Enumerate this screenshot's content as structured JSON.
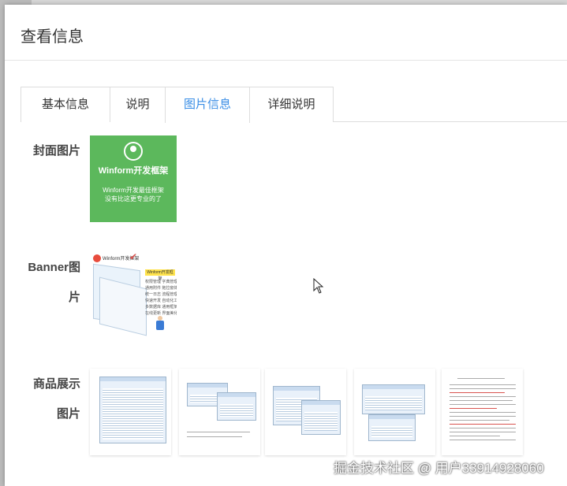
{
  "modal": {
    "title": "查看信息"
  },
  "tabs": [
    {
      "label": "基本信息",
      "active": false
    },
    {
      "label": "说明",
      "active": false
    },
    {
      "label": "图片信息",
      "active": true
    },
    {
      "label": "详细说明",
      "active": false
    }
  ],
  "cover": {
    "label": "封面图片",
    "image": {
      "heading": "Winform开发框架",
      "line1": "Winform开发最佳框架",
      "line2": "没有比这更专业的了",
      "bg_color": "#5cb85c"
    }
  },
  "banner": {
    "label_line1": "Banner图",
    "label_line2": "片",
    "image": {
      "title": "Winform开发框架",
      "box_text": "Winform开发框架",
      "features": [
        "权限管理  字典管理",
        "通用附件  拖拉窗体",
        "统一日志  流程管理",
        "快速开发  自动化工具",
        "多数据库  通用框架",
        "在线更新  界面美化"
      ]
    }
  },
  "gallery": {
    "label_line1": "商品展示",
    "label_line2": "图片"
  },
  "watermark": "掘金技术社区 @ 用户33914928060",
  "icons": {
    "cursor": "mouse-pointer-icon",
    "cover_icon": "user-circle-icon",
    "banner_logo": "logo-icon",
    "check": "check-icon"
  }
}
